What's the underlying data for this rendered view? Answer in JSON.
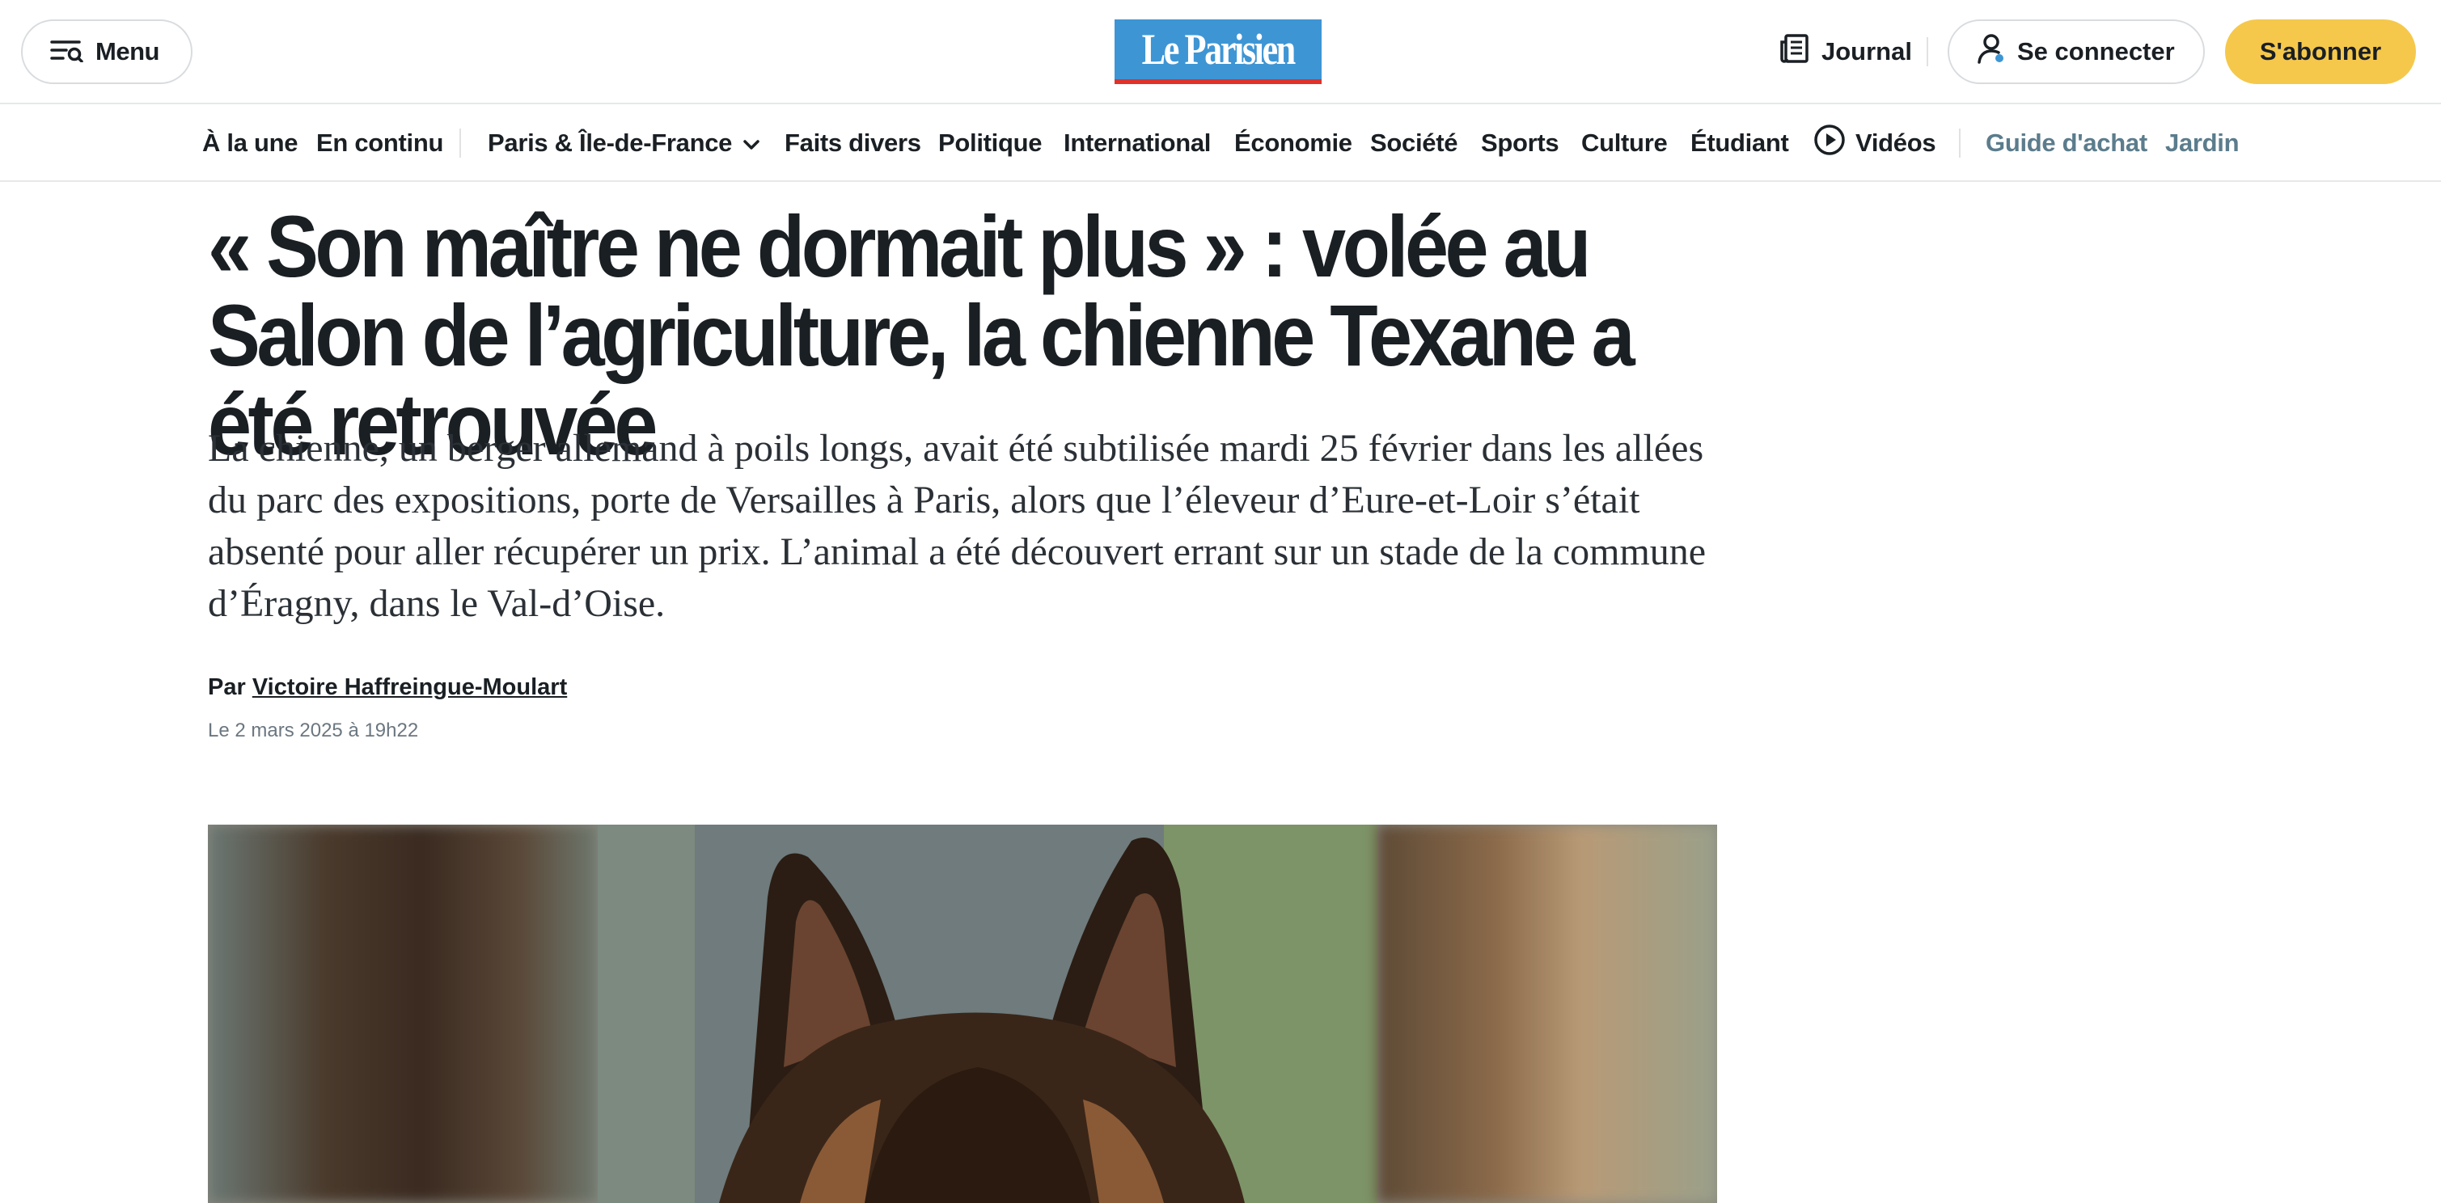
{
  "header": {
    "menu_label": "Menu",
    "logo_text": "Le Parisien",
    "journal_label": "Journal",
    "login_label": "Se connecter",
    "subscribe_label": "S'abonner"
  },
  "nav": {
    "items": [
      "À la une",
      "En continu",
      "Paris & Île-de-France",
      "Faits divers",
      "Politique",
      "International",
      "Économie",
      "Société",
      "Sports",
      "Culture",
      "Étudiant",
      "Vidéos",
      "Guide d'achat",
      "Jardin"
    ]
  },
  "article": {
    "headline": "« Son maître ne dormait plus » : volée au Salon de l’agriculture, la chienne Texane a été retrouvée",
    "lead": "La chienne, un berger allemand à poils longs, avait été subtilisée mardi 25 février dans les allées du parc des expositions, porte de Versailles à Paris, alors que l’éleveur d’Eure-et-Loir s’était absenté pour aller récupérer un prix. L’animal a été découvert errant sur un stade de la commune d’Éragny, dans le Val-d’Oise.",
    "byline_prefix": "Par",
    "author": "Victoire Haffreingue-Moulart",
    "date": "Le 2 mars 2025 à 19h22"
  },
  "colors": {
    "accent_yellow": "#f5c84c",
    "logo_blue": "#3e95d4",
    "logo_red": "#e0322a",
    "muted_nav": "#5b7c8c"
  },
  "icons": {
    "menu": "menu-lines-search-icon",
    "journal": "newspaper-icon",
    "login": "user-icon",
    "dropdown": "chevron-down-icon",
    "videos": "play-circle-icon"
  }
}
